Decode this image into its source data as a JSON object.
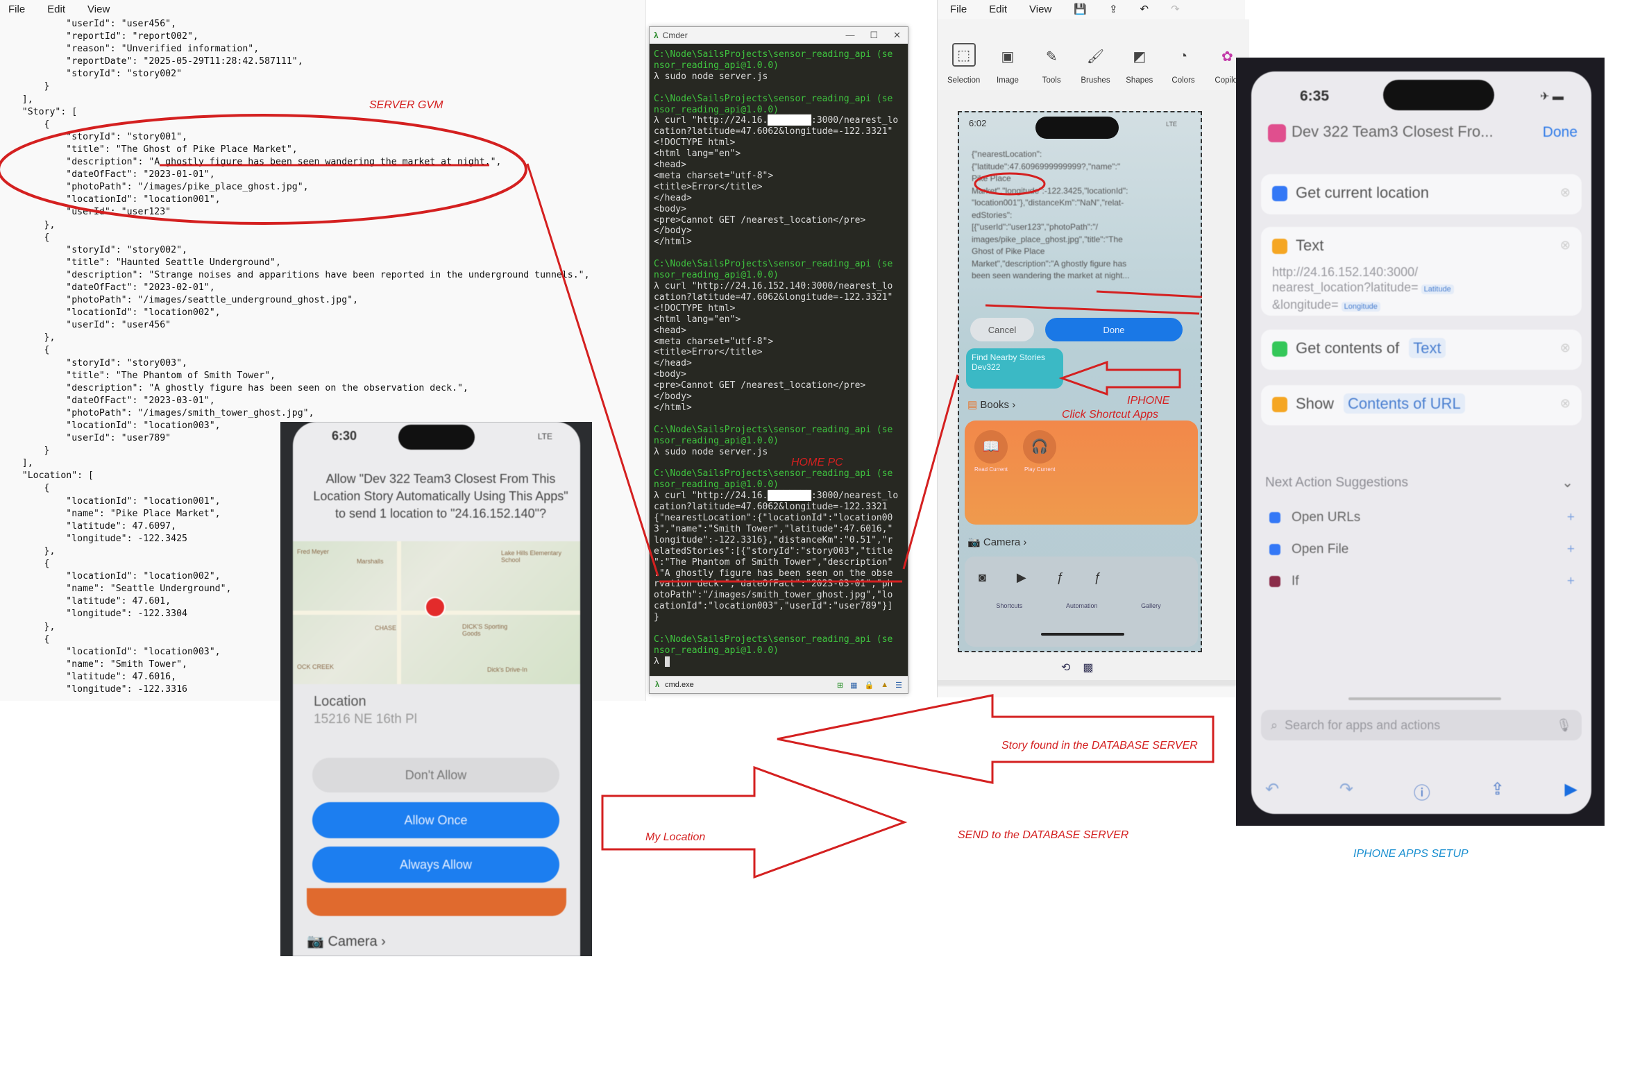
{
  "editor": {
    "menu": [
      "File",
      "Edit",
      "View"
    ],
    "lines": [
      "            \"userId\": \"user456\",",
      "            \"reportId\": \"report002\",",
      "            \"reason\": \"Unverified information\",",
      "            \"reportDate\": \"2025-05-29T11:28:42.587111\",",
      "            \"storyId\": \"story002\"",
      "        }",
      "    ],",
      "    \"Story\": [",
      "        {",
      "            \"storyId\": \"story001\",",
      "            \"title\": \"The Ghost of Pike Place Market\",",
      "            \"description\": \"A ghostly figure has been seen wandering the market at night.\",",
      "            \"dateOfFact\": \"2023-01-01\",",
      "            \"photoPath\": \"/images/pike_place_ghost.jpg\",",
      "            \"locationId\": \"location001\",",
      "            \"userId\": \"user123\"",
      "        },",
      "        {",
      "            \"storyId\": \"story002\",",
      "            \"title\": \"Haunted Seattle Underground\",",
      "            \"description\": \"Strange noises and apparitions have been reported in the underground tunnels.\",",
      "            \"dateOfFact\": \"2023-02-01\",",
      "            \"photoPath\": \"/images/seattle_underground_ghost.jpg\",",
      "            \"locationId\": \"location002\",",
      "            \"userId\": \"user456\"",
      "        },",
      "        {",
      "            \"storyId\": \"story003\",",
      "            \"title\": \"The Phantom of Smith Tower\",",
      "            \"description\": \"A ghostly figure has been seen on the observation deck.\",",
      "            \"dateOfFact\": \"2023-03-01\",",
      "            \"photoPath\": \"/images/smith_tower_ghost.jpg\",",
      "            \"locationId\": \"location003\",",
      "            \"userId\": \"user789\"",
      "        }",
      "    ],",
      "    \"Location\": [",
      "        {",
      "            \"locationId\": \"location001\",",
      "            \"name\": \"Pike Place Market\",",
      "            \"latitude\": 47.6097,",
      "            \"longitude\": -122.3425",
      "        },",
      "        {",
      "            \"locationId\": \"location002\",",
      "            \"name\": \"Seattle Underground\",",
      "            \"latitude\": 47.601,",
      "            \"longitude\": -122.3304",
      "        },",
      "        {",
      "            \"locationId\": \"location003\",",
      "            \"name\": \"Smith Tower\",",
      "            \"latitude\": 47.6016,",
      "            \"longitude\": -122.3316"
    ]
  },
  "cmder": {
    "title": "Cmder",
    "status_tab": "cmd.exe",
    "lines": [
      {
        "t": "path",
        "text": "C:\\Node\\SailsProjects\\sensor_reading_api (se"
      },
      {
        "t": "path",
        "text": "nsor_reading_api@1.0.0)"
      },
      {
        "t": "cmd",
        "text": "λ sudo node server.js"
      },
      {
        "t": "blank",
        "text": ""
      },
      {
        "t": "path",
        "text": "C:\\Node\\SailsProjects\\sensor_reading_api (se"
      },
      {
        "t": "path",
        "text": "nsor_reading_api@1.0.0)"
      },
      {
        "t": "cmd",
        "text": "λ curl \"http://24.16.████████:3000/nearest_lo"
      },
      {
        "t": "out",
        "text": "cation?latitude=47.6062&longitude=-122.3321\""
      },
      {
        "t": "out",
        "text": "<!DOCTYPE html>"
      },
      {
        "t": "out",
        "text": "<html lang=\"en\">"
      },
      {
        "t": "out",
        "text": "<head>"
      },
      {
        "t": "out",
        "text": "<meta charset=\"utf-8\">"
      },
      {
        "t": "out",
        "text": "<title>Error</title>"
      },
      {
        "t": "out",
        "text": "</head>"
      },
      {
        "t": "out",
        "text": "<body>"
      },
      {
        "t": "out",
        "text": "<pre>Cannot GET /nearest_location</pre>"
      },
      {
        "t": "out",
        "text": "</body>"
      },
      {
        "t": "out",
        "text": "</html>"
      },
      {
        "t": "blank",
        "text": ""
      },
      {
        "t": "path",
        "text": "C:\\Node\\SailsProjects\\sensor_reading_api (se"
      },
      {
        "t": "path",
        "text": "nsor_reading_api@1.0.0)"
      },
      {
        "t": "cmd",
        "text": "λ curl \"http://24.16.152.140:3000/nearest_lo"
      },
      {
        "t": "out",
        "text": "cation?latitude=47.6062&longitude=-122.3321\""
      },
      {
        "t": "out",
        "text": "<!DOCTYPE html>"
      },
      {
        "t": "out",
        "text": "<html lang=\"en\">"
      },
      {
        "t": "out",
        "text": "<head>"
      },
      {
        "t": "out",
        "text": "<meta charset=\"utf-8\">"
      },
      {
        "t": "out",
        "text": "<title>Error</title>"
      },
      {
        "t": "out",
        "text": "</head>"
      },
      {
        "t": "out",
        "text": "<body>"
      },
      {
        "t": "out",
        "text": "<pre>Cannot GET /nearest_location</pre>"
      },
      {
        "t": "out",
        "text": "</body>"
      },
      {
        "t": "out",
        "text": "</html>"
      },
      {
        "t": "blank",
        "text": ""
      },
      {
        "t": "path",
        "text": "C:\\Node\\SailsProjects\\sensor_reading_api (se"
      },
      {
        "t": "path",
        "text": "nsor_reading_api@1.0.0)"
      },
      {
        "t": "cmd",
        "text": "λ sudo node server.js"
      },
      {
        "t": "blank",
        "text": ""
      },
      {
        "t": "path",
        "text": "C:\\Node\\SailsProjects\\sensor_reading_api (se"
      },
      {
        "t": "path",
        "text": "nsor_reading_api@1.0.0)"
      },
      {
        "t": "cmd",
        "text": "λ curl \"http://24.16.████████:3000/nearest_lo"
      },
      {
        "t": "out",
        "text": "cation?latitude=47.6062&longitude=-122.3321"
      },
      {
        "t": "out",
        "text": "{\"nearestLocation\":{\"locationId\":\"location00"
      },
      {
        "t": "out",
        "text": "3\",\"name\":\"Smith Tower\",\"latitude\":47.6016,\""
      },
      {
        "t": "out",
        "text": "longitude\":-122.3316},\"distanceKm\":\"0.51\",\"r"
      },
      {
        "t": "out",
        "text": "elatedStories\":[{\"storyId\":\"story003\",\"title"
      },
      {
        "t": "out",
        "text": "\":\"The Phantom of Smith Tower\",\"description\""
      },
      {
        "t": "out",
        "text": ":\"A ghostly figure has been seen on the obse"
      },
      {
        "t": "out",
        "text": "rvation deck.\",\"dateOfFact\":\"2023-03-01\",\"ph"
      },
      {
        "t": "out",
        "text": "otoPath\":\"/images/smith_tower_ghost.jpg\",\"lo"
      },
      {
        "t": "out",
        "text": "cationId\":\"location003\",\"userId\":\"user789\"}]"
      },
      {
        "t": "out",
        "text": "}"
      },
      {
        "t": "blank",
        "text": ""
      },
      {
        "t": "path",
        "text": "C:\\Node\\SailsProjects\\sensor_reading_api (se"
      },
      {
        "t": "path",
        "text": "nsor_reading_api@1.0.0)"
      },
      {
        "t": "cmd",
        "text": "λ "
      }
    ]
  },
  "paint": {
    "menu": [
      "File",
      "Edit",
      "View"
    ],
    "tools": [
      {
        "label": "Selection",
        "icon": "selection-icon",
        "glyph": "⬚"
      },
      {
        "label": "Image",
        "icon": "image-icon",
        "glyph": "▣"
      },
      {
        "label": "Tools",
        "icon": "tools-icon",
        "glyph": "✎"
      },
      {
        "label": "Brushes",
        "icon": "brush-icon",
        "glyph": "🖌"
      },
      {
        "label": "Shapes",
        "icon": "shapes-icon",
        "glyph": "◩"
      },
      {
        "label": "Colors",
        "icon": "palette-icon",
        "glyph": "◔"
      },
      {
        "label": "Copilot",
        "icon": "copilot-icon",
        "glyph": "✿"
      }
    ],
    "phone": {
      "time": "6:02",
      "signal": "LTE",
      "json_preview": [
        "{\"nearestLocation\":",
        "{\"latitude\":47.6096999999999?,\"name\":\"",
        "Pike Place",
        "Market\",\"longitude\":-122.3425,\"locationId\":",
        "\"location001\"},\"distanceKm\":\"NaN\",\"relat-",
        "edStories\":",
        "[{\"userId\":\"user123\",\"photoPath\":\"/",
        "images/pike_place_ghost.jpg\",\"title\":\"The",
        "Ghost of Pike Place",
        "Market\",\"description\":\"A ghostly figure has",
        "been seen wandering the market at night..."
      ],
      "cancel": "Cancel",
      "done": "Done",
      "shortcut_tile": "Find Nearby Stories Dev322",
      "books": "Books",
      "read_current": "Read Current",
      "play_current": "Play Current",
      "camera": "Camera",
      "tabs": [
        "Shortcuts",
        "Automation",
        "Gallery"
      ]
    }
  },
  "shortcut_setup": {
    "time": "6:35",
    "title": "Dev 322 Team3 Closest Fro...",
    "done": "Done",
    "actions": [
      {
        "name": "Get current location",
        "color": "#3478f6"
      },
      {
        "name": "Text",
        "color": "#f5a623"
      },
      {
        "name": "Get contents of",
        "color": "#34c759",
        "param": "Text"
      },
      {
        "name": "Show",
        "color": "#f5a623",
        "param": "Contents of URL"
      }
    ],
    "text_body": [
      "http://24.16.152.140:3000/",
      "nearest_location?latitude=",
      "&longitude="
    ],
    "latitude_token": "Latitude",
    "longitude_token": "Longitude",
    "suggestions_header": "Next Action Suggestions",
    "suggestions": [
      "Open URLs",
      "Open File",
      "If"
    ],
    "search_placeholder": "Search for apps and actions"
  },
  "permission": {
    "time": "6:30",
    "signal": "LTE",
    "dialog_text": "Allow \"Dev 322 Team3 Closest From This Location Story Automatically Using This Apps\" to send 1 location to \"24.16.152.140\"?",
    "map_labels": [
      "Fred Meyer",
      "Marshalls",
      "Lake Hills Elementary School",
      "CHASE",
      "DICK'S Sporting Goods",
      "OCK CREEK",
      "Dick's Drive-In"
    ],
    "location_label": "Location",
    "location_value": "15216 NE 16th Pl",
    "dont_allow": "Don't Allow",
    "allow_once": "Allow Once",
    "always_allow": "Always Allow",
    "camera": "Camera"
  },
  "annotations": {
    "server_gvm": "SERVER GVM",
    "home_pc": "HOME PC",
    "iphone": "IPHONE",
    "click_shortcut": "Click Shortcut Apps",
    "story_found": "Story found in the DATABASE SERVER",
    "my_location": "My Location",
    "send_to_server": "SEND to the DATABASE SERVER",
    "iphone_setup": "IPHONE APPS SETUP",
    "annotation_red": "#d42020",
    "annotation_blue": "#1a8fd0"
  }
}
